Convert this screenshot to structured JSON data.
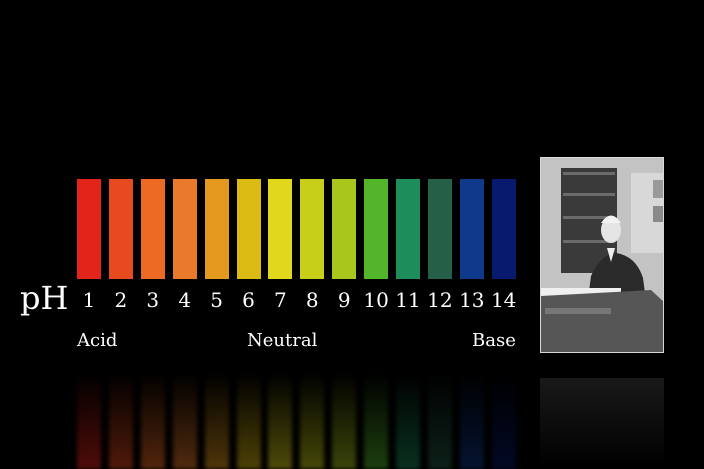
{
  "axis_label": "pH",
  "scale": [
    {
      "value": "1",
      "color": "#e3241b"
    },
    {
      "value": "2",
      "color": "#e84a1f"
    },
    {
      "value": "3",
      "color": "#ec6a24"
    },
    {
      "value": "4",
      "color": "#e9792b"
    },
    {
      "value": "5",
      "color": "#e39a1e"
    },
    {
      "value": "6",
      "color": "#dcba14"
    },
    {
      "value": "7",
      "color": "#e1d71c"
    },
    {
      "value": "8",
      "color": "#c8cf18"
    },
    {
      "value": "9",
      "color": "#a8c61c"
    },
    {
      "value": "10",
      "color": "#53b52a"
    },
    {
      "value": "11",
      "color": "#1c8d5b"
    },
    {
      "value": "12",
      "color": "#265f48"
    },
    {
      "value": "13",
      "color": "#0f3a8c"
    },
    {
      "value": "14",
      "color": "#081a6d"
    }
  ],
  "categories": {
    "acid": "Acid",
    "neutral": "Neutral",
    "base": "Base"
  },
  "photo": {
    "icon": "portrait-photo-icon"
  }
}
